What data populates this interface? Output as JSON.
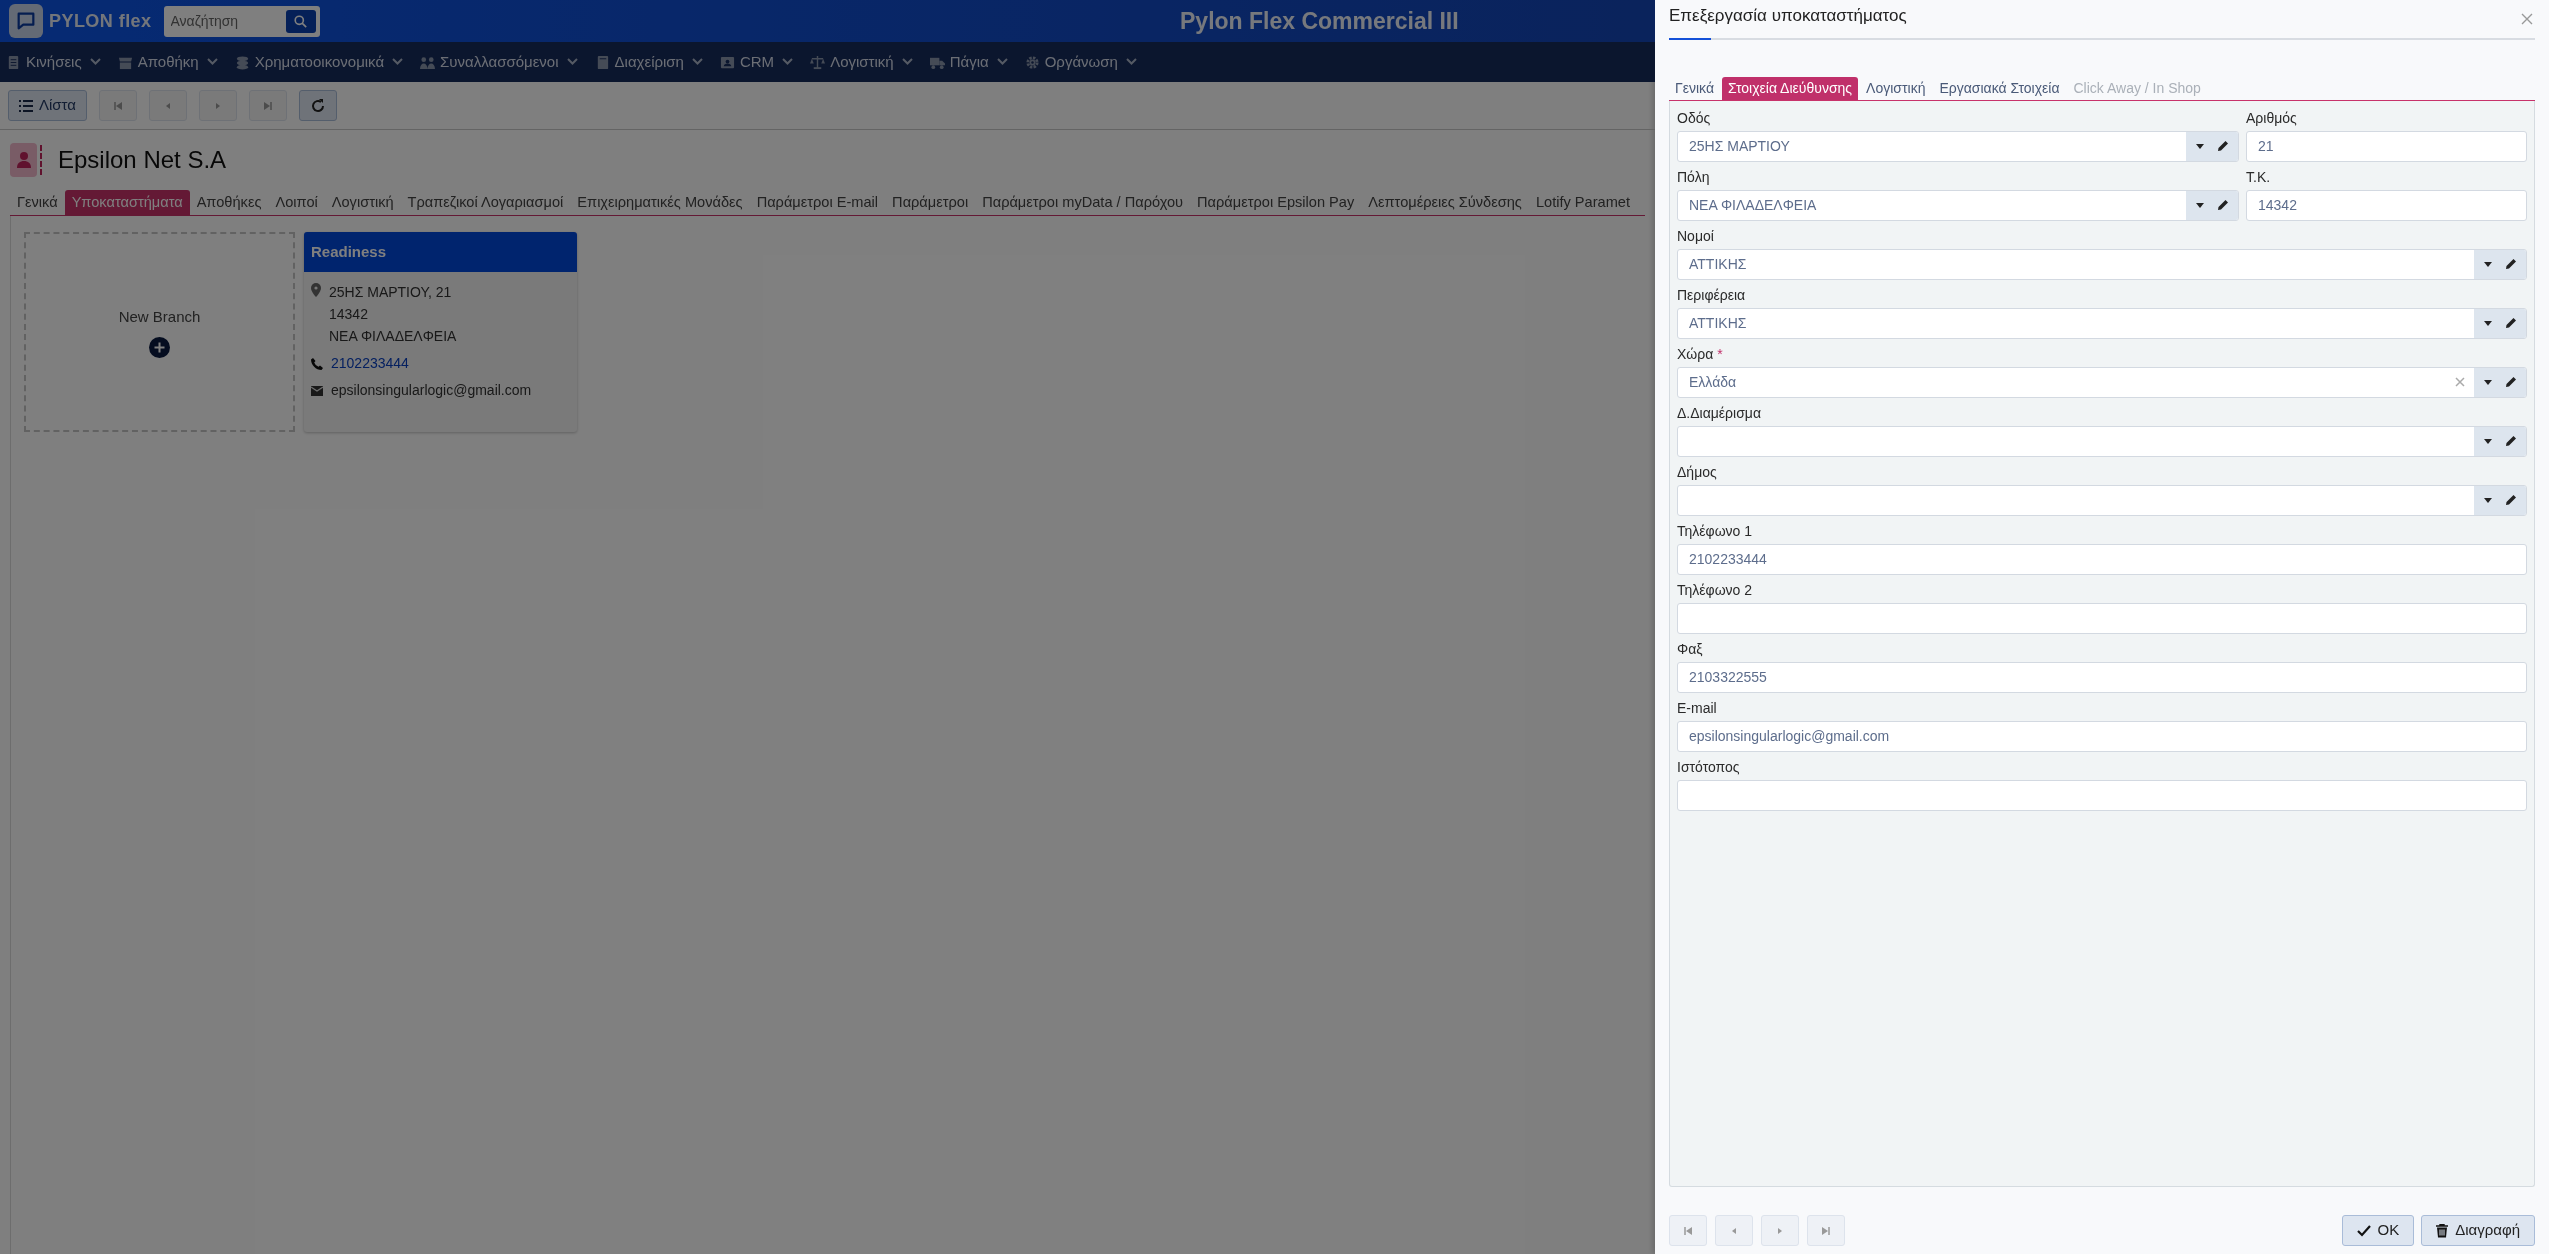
{
  "app": {
    "logo": "PYLON flex",
    "search_placeholder": "Αναζήτηση",
    "title": "Pylon Flex Commercial III"
  },
  "menu": [
    {
      "label": "Κινήσεις"
    },
    {
      "label": "Αποθήκη"
    },
    {
      "label": "Χρηματοοικονομικά"
    },
    {
      "label": "Συναλλασσόμενοι"
    },
    {
      "label": "Διαχείριση"
    },
    {
      "label": "CRM"
    },
    {
      "label": "Λογιστική"
    },
    {
      "label": "Πάγια"
    },
    {
      "label": "Οργάνωση"
    }
  ],
  "toolbar": {
    "list_button": "Λίστα"
  },
  "record": {
    "title": "Epsilon Net S.A"
  },
  "record_tabs": [
    {
      "label": "Γενικά",
      "selected": false
    },
    {
      "label": "Υποκαταστήματα",
      "selected": true
    },
    {
      "label": "Αποθήκες",
      "selected": false
    },
    {
      "label": "Λοιποί",
      "selected": false
    },
    {
      "label": "Λογιστική",
      "selected": false
    },
    {
      "label": "Τραπεζικοί Λογαριασμοί",
      "selected": false
    },
    {
      "label": "Επιχειρηματικές Μονάδες",
      "selected": false
    },
    {
      "label": "Παράμετροι E-mail",
      "selected": false
    },
    {
      "label": "Παράμετροι",
      "selected": false
    },
    {
      "label": "Παράμετροι myData / Παρόχου",
      "selected": false
    },
    {
      "label": "Παράμετροι Epsilon Pay",
      "selected": false
    },
    {
      "label": "Λεπτομέρειες Σύνδεσης",
      "selected": false
    },
    {
      "label": "Lotify Paramet",
      "selected": false
    }
  ],
  "branches": {
    "new_branch": "New Branch",
    "cards": [
      {
        "name": "Readiness",
        "address_lines": [
          "25ΗΣ ΜΑΡΤΙΟΥ, 21",
          "14342",
          "ΝΕΑ ΦΙΛΑΔΕΛΦΕΙΑ"
        ],
        "phone": "2102233444",
        "email": "epsilonsingularlogic@gmail.com"
      }
    ]
  },
  "dialog": {
    "title": "Επεξεργασία υποκαταστήματος",
    "tabs": [
      {
        "label": "Γενικά",
        "selected": false,
        "disabled": false
      },
      {
        "label": "Στοιχεία Διεύθυνσης",
        "selected": true,
        "disabled": false
      },
      {
        "label": "Λογιστική",
        "selected": false,
        "disabled": false
      },
      {
        "label": "Εργασιακά Στοιχεία",
        "selected": false,
        "disabled": false
      },
      {
        "label": "Click Away / In Shop",
        "selected": false,
        "disabled": true
      }
    ],
    "field_rows": [
      [
        {
          "label": "Οδός",
          "value": "25ΗΣ ΜΑΡΤΙΟΥ",
          "kind": "lookup",
          "clearable": false
        },
        {
          "label": "Αριθμός",
          "value": "21",
          "kind": "text",
          "clearable": false
        }
      ],
      [
        {
          "label": "Πόλη",
          "value": "ΝΕΑ ΦΙΛΑΔΕΛΦΕΙΑ",
          "kind": "lookup",
          "clearable": false
        },
        {
          "label": "Τ.Κ.",
          "value": "14342",
          "kind": "text",
          "clearable": false
        }
      ],
      [
        {
          "label": "Νομοί",
          "value": "ΑΤΤΙΚΗΣ",
          "kind": "lookup",
          "clearable": false
        }
      ],
      [
        {
          "label": "Περιφέρεια",
          "value": "ΑΤΤΙΚΗΣ",
          "kind": "lookup",
          "clearable": false
        }
      ],
      [
        {
          "label": "Χώρα",
          "required_mark": "*",
          "value": "Ελλάδα",
          "kind": "lookup",
          "clearable": true
        }
      ],
      [
        {
          "label": "Δ.Διαμέρισμα",
          "kind": "lookup",
          "clearable": false
        }
      ],
      [
        {
          "label": "Δήμος",
          "kind": "lookup",
          "clearable": false
        }
      ],
      [
        {
          "label": "Τηλέφωνο 1",
          "value": "2102233444",
          "kind": "text",
          "clearable": false
        }
      ],
      [
        {
          "label": "Τηλέφωνο 2",
          "kind": "text",
          "clearable": false
        }
      ],
      [
        {
          "label": "Φαξ",
          "value": "2103322555",
          "kind": "text",
          "clearable": false
        }
      ],
      [
        {
          "label": "E-mail",
          "value": "epsilonsingularlogic@gmail.com",
          "kind": "text",
          "clearable": false
        }
      ],
      [
        {
          "label": "Ιστότοπος",
          "kind": "text",
          "clearable": false
        }
      ]
    ],
    "buttons": [
      {
        "label": "OK",
        "kind": "ok"
      },
      {
        "label": "Διαγραφή",
        "kind": "delete"
      }
    ]
  }
}
